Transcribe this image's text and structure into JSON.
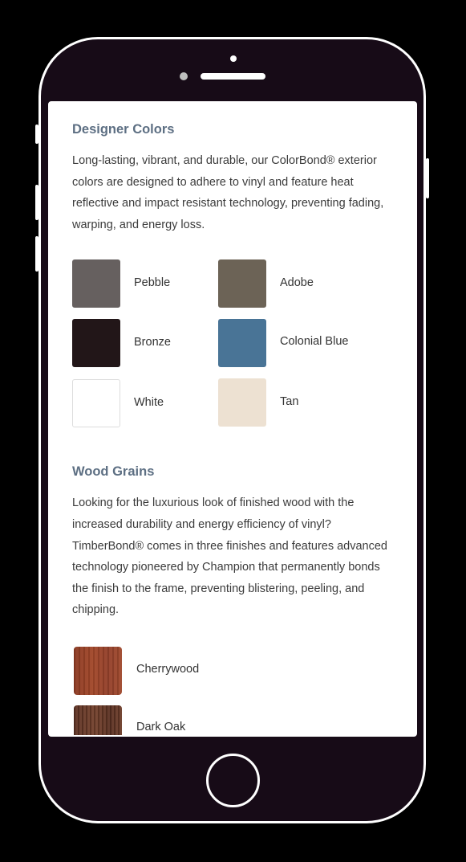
{
  "designer_colors": {
    "title": "Designer Colors",
    "description": "Long-lasting, vibrant, and durable, our ColorBond® exterior colors are designed to adhere to vinyl and feature heat reflective and impact resistant technology, preventing fading, warping, and energy loss.",
    "colors": [
      {
        "name": "Pebble",
        "hex": "#66605f"
      },
      {
        "name": "Adobe",
        "hex": "#6c6356"
      },
      {
        "name": "Bronze",
        "hex": "#221618"
      },
      {
        "name": "Colonial Blue",
        "hex": "#497496"
      },
      {
        "name": "White",
        "hex": "#ffffff"
      },
      {
        "name": "Tan",
        "hex": "#ede1d2"
      }
    ]
  },
  "wood_grains": {
    "title": "Wood Grains",
    "description": "Looking for the luxurious look of finished wood with the increased durability and energy efficiency of vinyl? TimberBond® comes in three finishes and features advanced technology pioneered by Champion that permanently bonds the finish to the frame, preventing blistering, peeling, and chipping.",
    "finishes": [
      {
        "name": "Cherrywood"
      },
      {
        "name": "Dark Oak"
      }
    ]
  },
  "colors": {
    "title_text": "#5d6f83",
    "phone_body": "#170b17",
    "phone_outline": "#ffffff"
  }
}
